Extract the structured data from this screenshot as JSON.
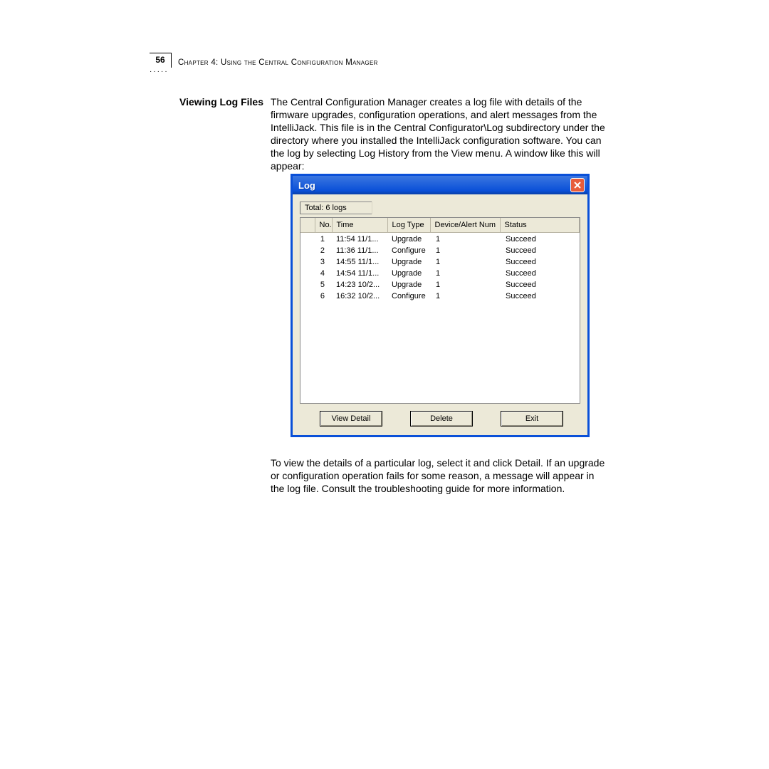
{
  "header": {
    "page_number": "56",
    "chapter_label": "Chapter 4: Using the Central Configuration Manager"
  },
  "section": {
    "heading": "Viewing Log Files",
    "para1": "The Central Configuration Manager creates a log file with details of the firmware upgrades, configuration operations, and alert messages from the IntelliJack. This file is in the Central Configurator\\Log subdirectory under the directory where you installed the IntelliJack configuration software. You can the log by selecting Log History from the View menu. A window like this will appear:",
    "para2": "To view the details of a particular log, select it and click Detail. If an upgrade or configuration operation fails for some reason, a message will appear in the log file. Consult the troubleshooting guide for more information."
  },
  "dialog": {
    "title": "Log",
    "total_label": "Total: 6 logs",
    "columns": {
      "icon": "",
      "no": "No.",
      "time": "Time",
      "type": "Log Type",
      "device": "Device/Alert Num",
      "status": "Status"
    },
    "rows": [
      {
        "no": "1",
        "time": "11:54 11/1...",
        "type": "Upgrade",
        "device": "1",
        "status": "Succeed"
      },
      {
        "no": "2",
        "time": "11:36 11/1...",
        "type": "Configure",
        "device": "1",
        "status": "Succeed"
      },
      {
        "no": "3",
        "time": "14:55 11/1...",
        "type": "Upgrade",
        "device": "1",
        "status": "Succeed"
      },
      {
        "no": "4",
        "time": "14:54 11/1...",
        "type": "Upgrade",
        "device": "1",
        "status": "Succeed"
      },
      {
        "no": "5",
        "time": "14:23 10/2...",
        "type": "Upgrade",
        "device": "1",
        "status": "Succeed"
      },
      {
        "no": "6",
        "time": "16:32 10/2...",
        "type": "Configure",
        "device": "1",
        "status": "Succeed"
      }
    ],
    "buttons": {
      "view_detail": "View Detail",
      "delete": "Delete",
      "exit": "Exit"
    }
  }
}
